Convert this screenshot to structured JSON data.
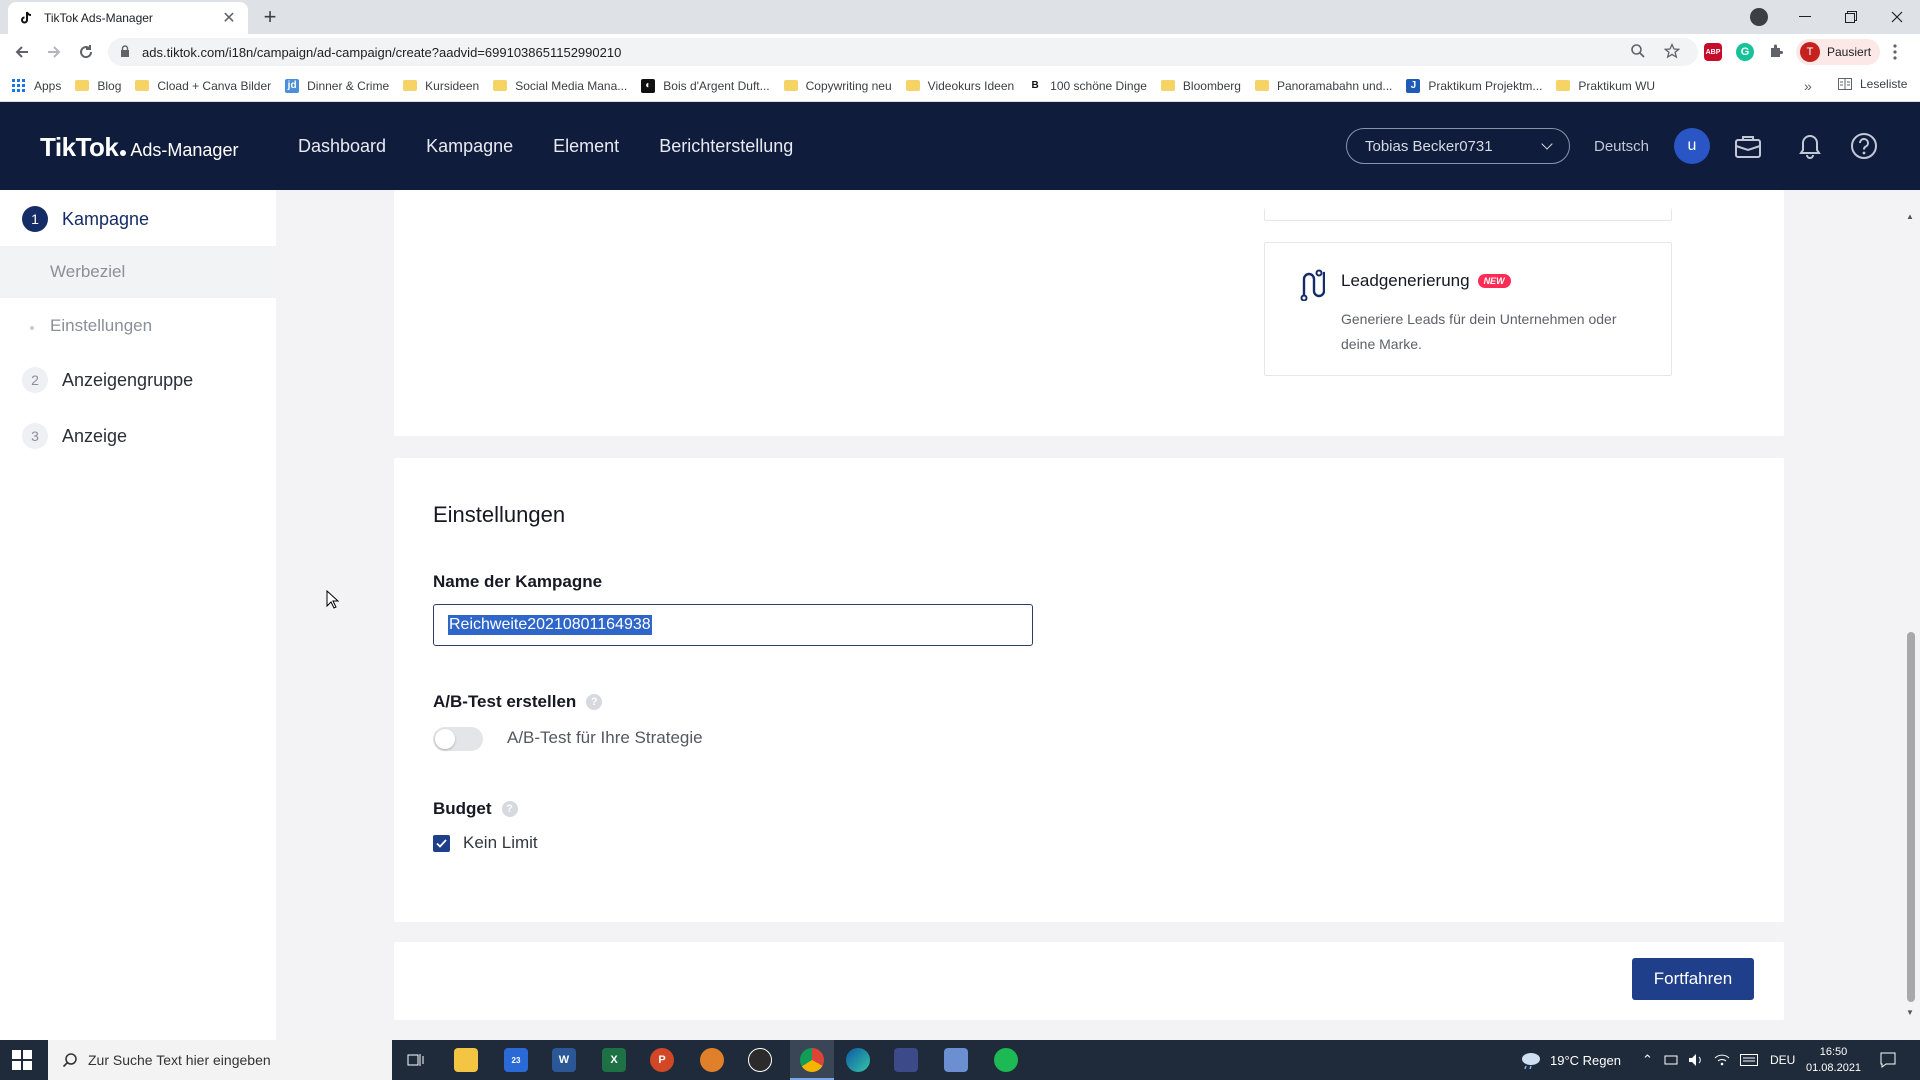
{
  "browser": {
    "tab_title": "TikTok Ads-Manager",
    "tab_close": "✕",
    "new_tab": "+",
    "url": "ads.tiktok.com/i18n/campaign/ad-campaign/create?aadvid=6991038651152990210",
    "profile_initial": "T",
    "profile_label": "Pausiert",
    "ext_abp": "ABP",
    "ext_grammarly": "G",
    "bookmarks": [
      {
        "label": "Apps",
        "icon": "apps-icon"
      },
      {
        "label": "Blog",
        "icon": "folder-icon"
      },
      {
        "label": "Cload + Canva Bilder",
        "icon": "folder-icon"
      },
      {
        "label": "Dinner & Crime",
        "icon": "jd-icon"
      },
      {
        "label": "Kursideen",
        "icon": "folder-icon"
      },
      {
        "label": "Social Media Mana...",
        "icon": "folder-icon"
      },
      {
        "label": "Bois d'Argent Duft...",
        "icon": "bd-icon"
      },
      {
        "label": "Copywriting neu",
        "icon": "folder-icon"
      },
      {
        "label": "Videokurs Ideen",
        "icon": "folder-icon"
      },
      {
        "label": "100 schöne Dinge",
        "icon": "b-icon"
      },
      {
        "label": "Bloomberg",
        "icon": "folder-icon"
      },
      {
        "label": "Panoramabahn und...",
        "icon": "folder-icon"
      },
      {
        "label": "Praktikum Projektm...",
        "icon": "j-icon"
      },
      {
        "label": "Praktikum WU",
        "icon": "folder-icon"
      }
    ],
    "bookmarks_more": "»",
    "reading_list": "Leseliste"
  },
  "header": {
    "logo_brand": "TikTok",
    "logo_suffix": "Ads-Manager",
    "nav": [
      "Dashboard",
      "Kampagne",
      "Element",
      "Berichterstellung"
    ],
    "account": "Tobias Becker0731",
    "language": "Deutsch",
    "avatar_initial": "u"
  },
  "sidebar": {
    "steps": [
      {
        "num": "1",
        "label": "Kampagne"
      },
      {
        "num": "2",
        "label": "Anzeigengruppe"
      },
      {
        "num": "3",
        "label": "Anzeige"
      }
    ],
    "sub_items": [
      "Werbeziel",
      "Einstellungen"
    ]
  },
  "objective": {
    "title": "Leadgenerierung",
    "badge": "NEW",
    "description": "Generiere Leads für dein Unternehmen oder deine Marke."
  },
  "settings": {
    "section_title": "Einstellungen",
    "name_label": "Name der Kampagne",
    "name_value": "Reichweite20210801164938",
    "ab_label": "A/B-Test erstellen",
    "ab_toggle_label": "A/B-Test für Ihre Strategie",
    "budget_label": "Budget",
    "budget_checkbox_label": "Kein Limit",
    "help_glyph": "?"
  },
  "footer": {
    "continue_button": "Fortfahren"
  },
  "taskbar": {
    "search_placeholder": "Zur Suche Text hier eingeben",
    "mail_badge": "23",
    "weather": "19°C  Regen",
    "keyboard_lang": "DEU",
    "time": "16:50",
    "date": "01.08.2021"
  },
  "colors": {
    "header_bg": "#0f1c3c",
    "primary": "#1f3f8a",
    "badge_new": "#fe2c55"
  }
}
